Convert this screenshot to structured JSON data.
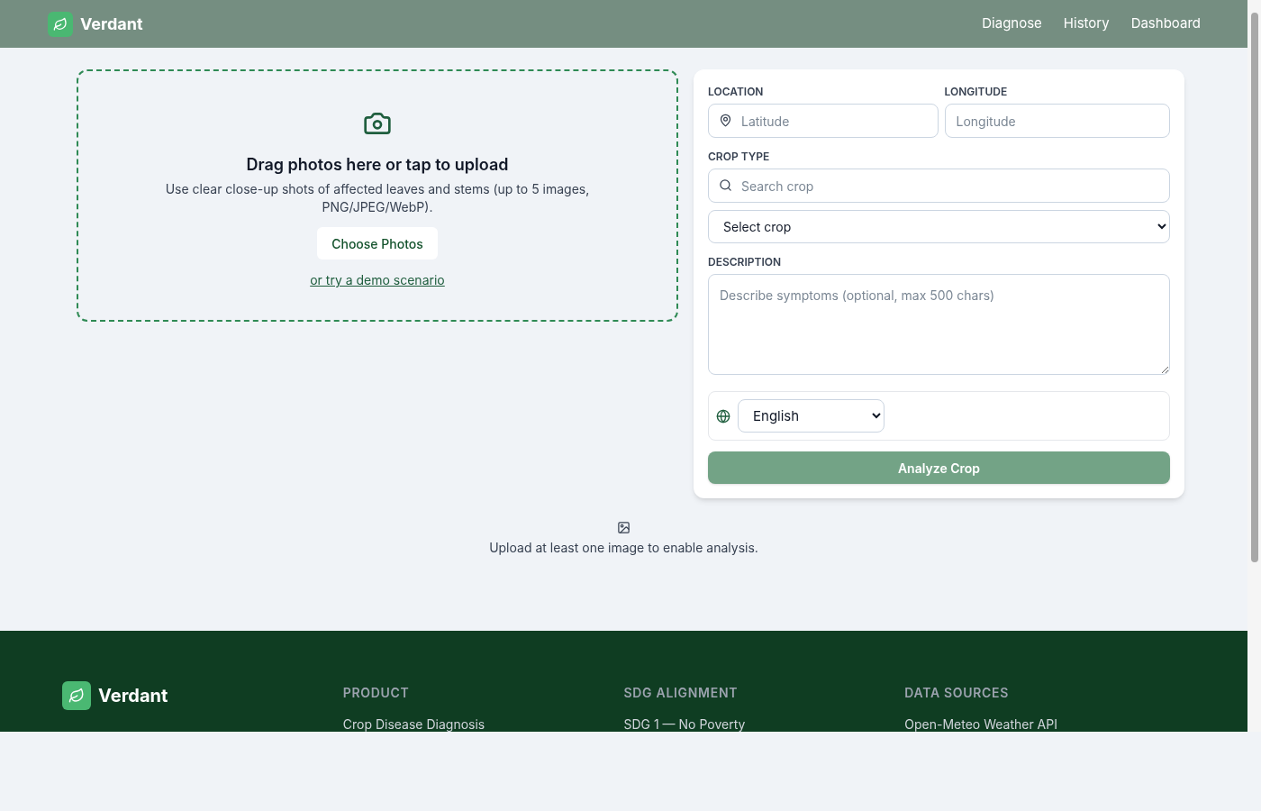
{
  "header": {
    "brand": "Verdant",
    "nav": [
      "Diagnose",
      "History",
      "Dashboard"
    ]
  },
  "upload": {
    "title": "Drag photos here or tap to upload",
    "hint": "Use clear close-up shots of affected leaves and stems (up to 5 images, PNG/JPEG/WebP).",
    "button": "Choose Photos",
    "demo_link": "or try a demo scenario"
  },
  "form": {
    "location_label": "LOCATION",
    "latitude_placeholder": "Latitude",
    "longitude_label": "LONGITUDE",
    "longitude_placeholder": "Longitude",
    "crop_label": "CROP TYPE",
    "crop_search_placeholder": "Search crop",
    "crop_select": "Select crop",
    "description_label": "DESCRIPTION",
    "description_placeholder": "Describe symptoms (optional, max 500 chars)",
    "language": "English",
    "submit": {
      "label": "Analyze Crop",
      "disabled": true
    }
  },
  "notice": "Upload at least one image to enable analysis.",
  "footer": {
    "brand": "Verdant",
    "columns": [
      {
        "heading": "PRODUCT",
        "items": [
          "Crop Disease Diagnosis"
        ]
      },
      {
        "heading": "SDG ALIGNMENT",
        "items": [
          "SDG 1 — No Poverty"
        ]
      },
      {
        "heading": "DATA SOURCES",
        "items": [
          "Open-Meteo Weather API"
        ]
      }
    ]
  }
}
